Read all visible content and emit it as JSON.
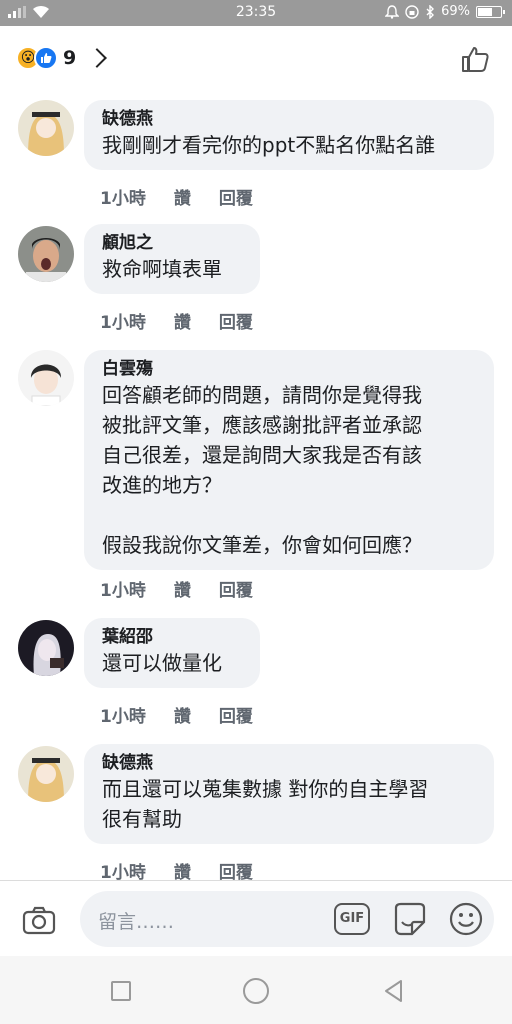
{
  "status_bar": {
    "time": "23:35",
    "battery": "69%",
    "battery_level": 0.69
  },
  "header": {
    "reaction_count": "9"
  },
  "comments": [
    {
      "author": "缺德燕",
      "text": "我剛剛才看完你的ppt不點名你點名誰",
      "time": "1小時",
      "like": "讚",
      "reply": "回覆"
    },
    {
      "author": "顧旭之",
      "text": "救命啊填表單",
      "time": "1小時",
      "like": "讚",
      "reply": "回覆"
    },
    {
      "author": "白雲殤",
      "text": "回答顧老師的問題，請問你是覺得我\n被批評文筆，應該感謝批評者並承認\n自己很差，還是詢問大家我是否有該\n改進的地方？\n\n假設我說你文筆差，你會如何回應？",
      "time": "1小時",
      "like": "讚",
      "reply": "回覆"
    },
    {
      "author": "葉紹邵",
      "text": "還可以做量化",
      "time": "1小時",
      "like": "讚",
      "reply": "回覆"
    },
    {
      "author": "缺德燕",
      "text": "而且還可以蒐集數據 對你的自主學習\n很有幫助",
      "time": "1小時",
      "like": "讚",
      "reply": "回覆"
    }
  ],
  "composer": {
    "placeholder": "留言……",
    "gif_label": "GIF"
  },
  "colors": {
    "like_blue": "#1877f2",
    "bubble_bg": "#f0f2f5",
    "meta_gray": "#606770"
  }
}
